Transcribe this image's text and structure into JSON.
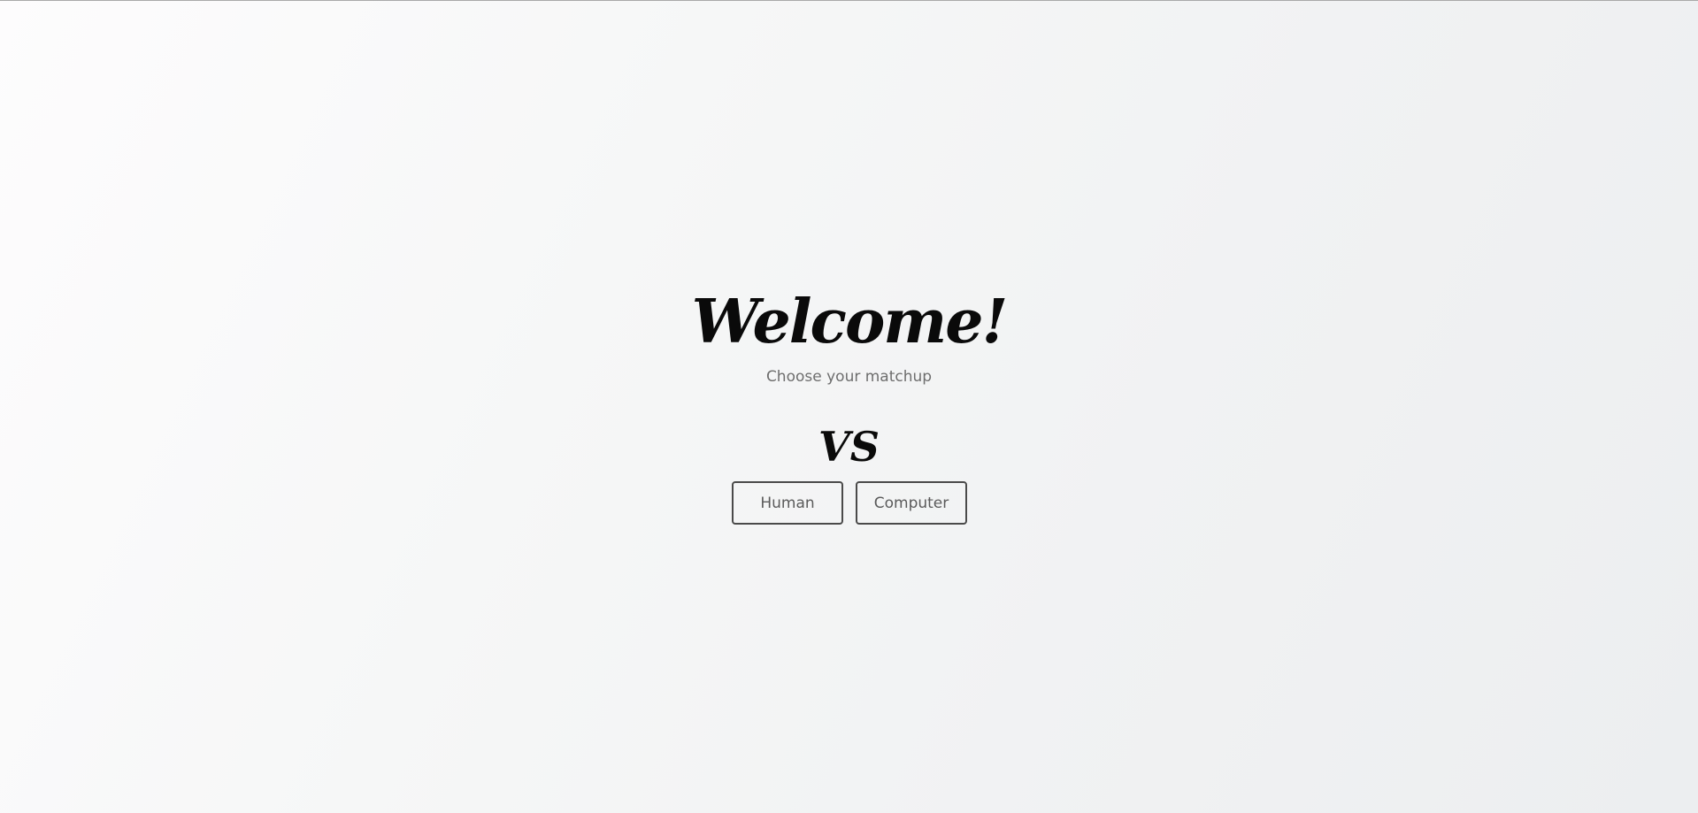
{
  "welcome": {
    "title": "Welcome!",
    "subtitle": "Choose your matchup",
    "vs_label": "VS"
  },
  "matchup": {
    "options": [
      {
        "label": "Human"
      },
      {
        "label": "Computer"
      }
    ]
  },
  "colors": {
    "title": "#0a0a0a",
    "subtitle": "#6e6e6e",
    "button_border": "#4a4a4a",
    "button_text": "#5a5a5a"
  }
}
